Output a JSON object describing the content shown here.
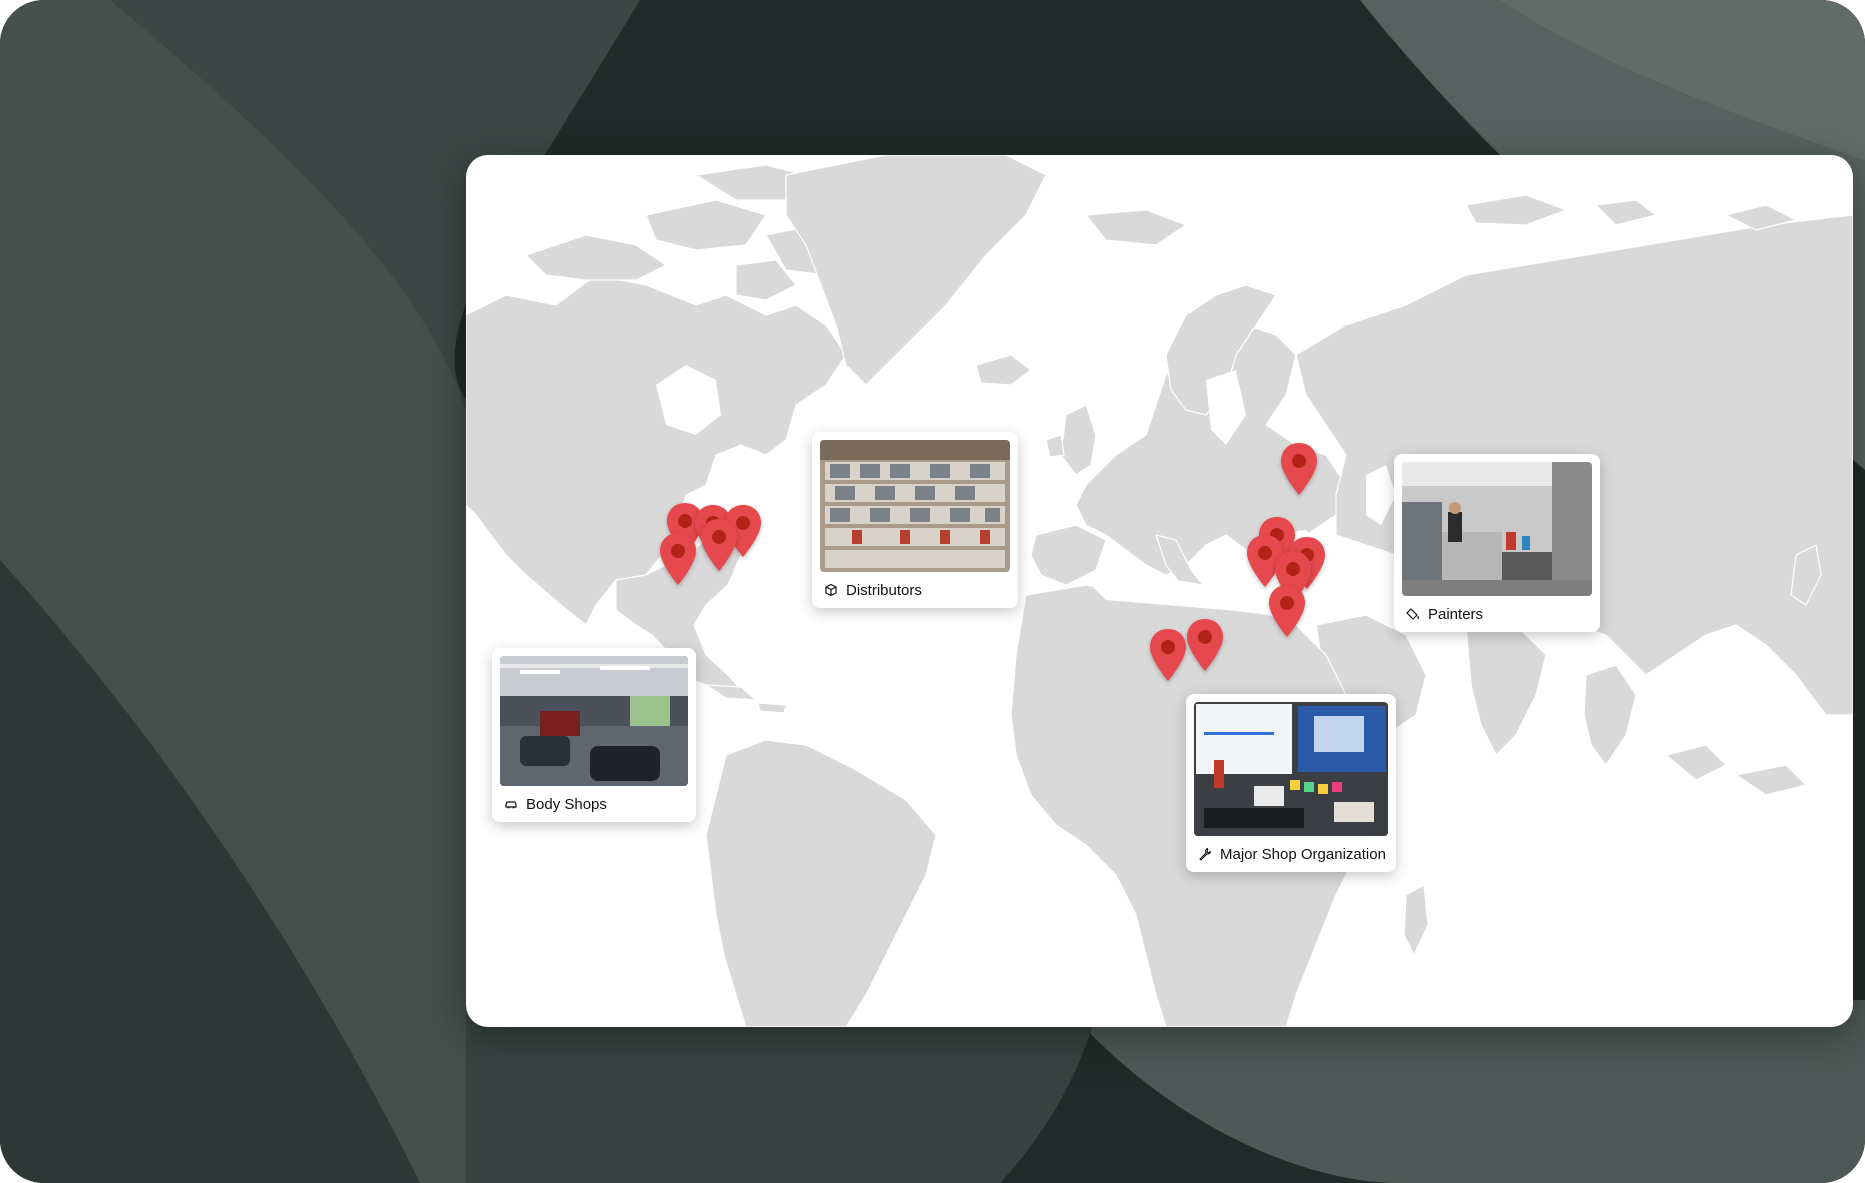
{
  "map": {
    "colors": {
      "land": "#d9d9d9",
      "borders": "#ffffff",
      "ocean": "#ffffff",
      "pin": "#e5484d",
      "pin_dot": "#b42318"
    }
  },
  "callouts": [
    {
      "id": "body-shops",
      "label": "Body Shops",
      "icon": "car-icon"
    },
    {
      "id": "distributors",
      "label": "Distributors",
      "icon": "package-icon"
    },
    {
      "id": "painters",
      "label": "Painters",
      "icon": "paint-bucket-icon"
    },
    {
      "id": "major-shop",
      "label": "Major Shop Organization",
      "icon": "wrench-icon"
    }
  ],
  "pins": [
    {
      "region": "North America"
    },
    {
      "region": "North America"
    },
    {
      "region": "North America"
    },
    {
      "region": "North America"
    },
    {
      "region": "North America"
    },
    {
      "region": "Europe"
    },
    {
      "region": "Europe"
    },
    {
      "region": "Europe"
    },
    {
      "region": "Europe"
    },
    {
      "region": "Europe"
    },
    {
      "region": "Europe"
    },
    {
      "region": "Europe"
    },
    {
      "region": "Europe"
    }
  ]
}
